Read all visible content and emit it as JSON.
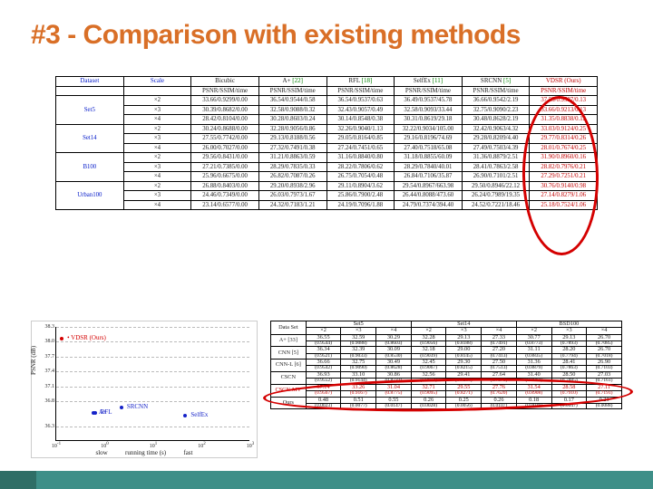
{
  "title": "#3 - Comparison with existing methods",
  "table1": {
    "head": [
      "Dataset",
      "Scale",
      "Bicubic",
      "A+",
      "RFL",
      "SelfEx",
      "SRCNN",
      "VDSR (Ours)"
    ],
    "sub": [
      "",
      "",
      "PSNR/SSIM/time",
      "PSNR/SSIM/time",
      "PSNR/SSIM/time",
      "PSNR/SSIM/time",
      "PSNR/SSIM/time",
      "PSNR/SSIM/time"
    ],
    "cites": {
      "A+": "[22]",
      "RFL": "[18]",
      "SelfEx": "[11]",
      "SRCNN": "[5]"
    },
    "rows": [
      {
        "d": "Set5",
        "s": "×2",
        "v": [
          "33.66/0.9299/0.00",
          "36.54/0.9544/0.58",
          "36.54/0.9537/0.63",
          "36.49/0.9537/45.78",
          "36.66/0.9542/2.19",
          "37.53/0.9587/0.13"
        ]
      },
      {
        "d": "",
        "s": "×3",
        "v": [
          "30.39/0.8682/0.00",
          "32.58/0.9088/0.32",
          "32.43/0.9057/0.49",
          "32.58/0.9093/33.44",
          "32.75/0.9090/2.23",
          "33.66/0.9213/0.13"
        ]
      },
      {
        "d": "",
        "s": "×4",
        "v": [
          "28.42/0.8104/0.00",
          "30.28/0.8603/0.24",
          "30.14/0.8548/0.38",
          "30.31/0.8619/29.18",
          "30.48/0.8628/2.19",
          "31.35/0.8838/0.12"
        ]
      },
      {
        "d": "Set14",
        "s": "×2",
        "v": [
          "30.24/0.8688/0.00",
          "32.28/0.9056/0.86",
          "32.26/0.9040/1.13",
          "32.22/0.9034/105.00",
          "32.42/0.9063/4.32",
          "33.03/0.9124/0.25"
        ]
      },
      {
        "d": "",
        "s": "×3",
        "v": [
          "27.55/0.7742/0.00",
          "29.13/0.8188/0.56",
          "29.05/0.8164/0.85",
          "29.16/0.8196/74.69",
          "29.28/0.8209/4.40",
          "29.77/0.8314/0.26"
        ]
      },
      {
        "d": "",
        "s": "×4",
        "v": [
          "26.00/0.7027/0.00",
          "27.32/0.7491/0.38",
          "27.24/0.7451/0.65",
          "27.40/0.7518/65.08",
          "27.49/0.7503/4.39",
          "28.01/0.7674/0.25"
        ]
      },
      {
        "d": "B100",
        "s": "×2",
        "v": [
          "29.56/0.8431/0.00",
          "31.21/0.8863/0.59",
          "31.16/0.8840/0.80",
          "31.18/0.8855/60.09",
          "31.36/0.8879/2.51",
          "31.90/0.8960/0.16"
        ]
      },
      {
        "d": "",
        "s": "×3",
        "v": [
          "27.21/0.7385/0.00",
          "28.29/0.7835/0.33",
          "28.22/0.7806/0.62",
          "28.29/0.7840/40.01",
          "28.41/0.7863/2.58",
          "28.82/0.7976/0.21"
        ]
      },
      {
        "d": "",
        "s": "×4",
        "v": [
          "25.96/0.6675/0.00",
          "26.82/0.7087/0.26",
          "26.75/0.7054/0.48",
          "26.84/0.7106/35.87",
          "26.90/0.7101/2.51",
          "27.29/0.7251/0.21"
        ]
      },
      {
        "d": "Urban100",
        "s": "×2",
        "v": [
          "26.88/0.8403/0.00",
          "29.20/0.8938/2.96",
          "29.11/0.8904/3.62",
          "29.54/0.8967/663.98",
          "29.50/0.8946/22.12",
          "30.76/0.9140/0.98"
        ]
      },
      {
        "d": "",
        "s": "×3",
        "v": [
          "24.46/0.7349/0.00",
          "26.03/0.7973/1.67",
          "25.86/0.7900/2.48",
          "26.44/0.8088/473.60",
          "26.24/0.7989/19.35",
          "27.14/0.8279/1.06"
        ]
      },
      {
        "d": "",
        "s": "×4",
        "v": [
          "23.14/0.6577/0.00",
          "24.32/0.7183/1.21",
          "24.19/0.7096/1.88",
          "24.79/0.7374/394.40",
          "24.52/0.7221/18.46",
          "25.18/0.7524/1.06"
        ]
      }
    ]
  },
  "table2": {
    "datasets": [
      "Set5",
      "Set14",
      "BSD100"
    ],
    "scales": [
      "×2",
      "×3",
      "×4",
      "×2",
      "×3",
      "×4",
      "×2",
      "×3",
      "×4"
    ],
    "rows": [
      {
        "m": "A+ [33]",
        "v": [
          "36.55",
          "32.59",
          "30.29",
          "32.28",
          "29.13",
          "27.33",
          "30.77",
          "29.13",
          "26.70"
        ],
        "s": [
          "(0.9544)",
          "(0.9088)",
          "(0.8603)",
          "(0.9056)",
          "(0.8188)",
          "(0.7491)",
          "(0.8773)",
          "(0.7893)",
          "(0.7085)"
        ]
      },
      {
        "m": "CNN [5]",
        "v": [
          "36.34",
          "32.39",
          "30.09",
          "32.18",
          "29.00",
          "27.20",
          "31.11",
          "28.20",
          "26.70"
        ],
        "s": [
          "(0.9521)",
          "(0.9033)",
          "(0.8530)",
          "(0.9039)",
          "(0.8145)",
          "(0.7413)",
          "(0.8835)",
          "(0.7794)",
          "(0.7018)"
        ]
      },
      {
        "m": "CNN-L [6]",
        "v": [
          "36.66",
          "32.75",
          "30.49",
          "32.45",
          "29.30",
          "27.50",
          "31.36",
          "28.41",
          "26.90"
        ],
        "s": [
          "(0.9542)",
          "(0.9090)",
          "(0.8628)",
          "(0.9067)",
          "(0.8215)",
          "(0.7513)",
          "(0.8879)",
          "(0.7863)",
          "(0.7103)"
        ]
      },
      {
        "m": "CSCN",
        "v": [
          "36.93",
          "33.10",
          "30.86",
          "32.56",
          "29.41",
          "27.64",
          "31.40",
          "28.50",
          "27.03"
        ],
        "s": [
          "(0.9552)",
          "(0.9144)",
          "(0.8732)",
          "(0.9074)",
          "(0.8238)",
          "(0.7578)",
          "(0.8884)",
          "(0.7885)",
          "(0.7161)"
        ]
      },
      {
        "m": "CSCN-MV",
        "ours": true,
        "v": [
          "37.14",
          "33.26",
          "31.04",
          "32.71",
          "29.55",
          "27.76",
          "31.54",
          "28.58",
          "27.11"
        ],
        "s": [
          "(0.9567)",
          "(0.9167)",
          "(0.8775)",
          "(0.9095)",
          "(0.8271)",
          "(0.7620)",
          "(0.8908)",
          "(0.7910)",
          "(0.7191)"
        ]
      },
      {
        "m": "Ours",
        "v": [
          "0.48",
          "0.51",
          "0.55",
          "0.26",
          "0.25",
          "0.26",
          "0.18",
          "0.17",
          "0.21"
        ],
        "s": [
          "(0.0023)",
          "(0.0077)",
          "(0.0147)",
          "(0.0028)",
          "(0.0056)",
          "(0.0107)",
          "(0.0029)",
          "(0.0047)",
          "(0.0088)"
        ]
      }
    ]
  },
  "chart_data": {
    "type": "scatter",
    "title": "",
    "xlabel": "running time (s)",
    "ylabel": "PSNR (dB)",
    "xscale": "log",
    "xticks": [
      "10^-1",
      "10^0",
      "10^1",
      "10^2",
      "10^3"
    ],
    "extra_x_labels": {
      "left": "fast",
      "right": "slow"
    },
    "ylim": [
      36.0,
      38.3
    ],
    "yticks": [
      36.3,
      36.8,
      37.1,
      37.4,
      37.7,
      38.0,
      38.3
    ],
    "series": [
      {
        "name": "VDSR (Ours)",
        "color": "#d40000",
        "x": 0.13,
        "y": 38.05
      },
      {
        "name": "SRCNN",
        "color": "#1522c8",
        "x": 2.2,
        "y": 36.66
      },
      {
        "name": "SelfEx",
        "color": "#1522c8",
        "x": 45.8,
        "y": 36.49
      },
      {
        "name": "RFL",
        "color": "#1522c8",
        "x": 0.63,
        "y": 36.54
      },
      {
        "name": "A+",
        "color": "#1522c8",
        "x": 0.58,
        "y": 36.54
      }
    ]
  },
  "annots": [
    "main-ours-column",
    "cscn-mv-row"
  ]
}
